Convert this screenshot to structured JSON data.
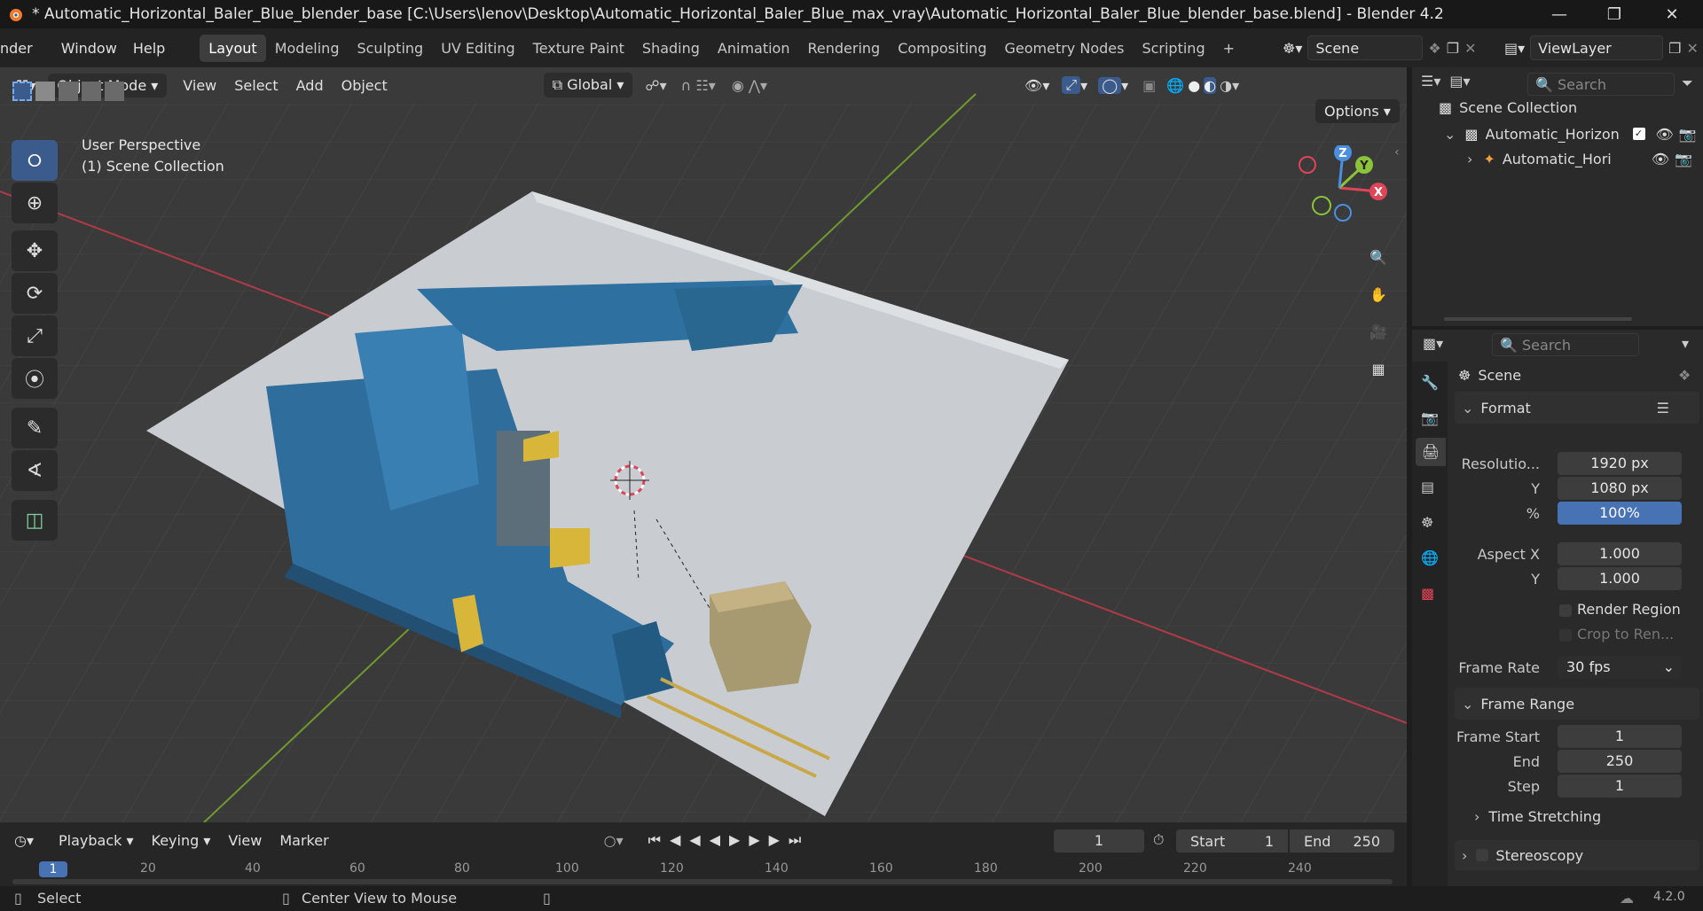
{
  "app": {
    "title": "* Automatic_Horizontal_Baler_Blue_blender_base [C:\\Users\\lenov\\Desktop\\Automatic_Horizontal_Baler_Blue_max_vray\\Automatic_Horizontal_Baler_Blue_blender_base.blend] - Blender 4.2"
  },
  "menu": {
    "items": [
      "nder",
      "Window",
      "Help"
    ]
  },
  "workspaces": {
    "tabs": [
      "Layout",
      "Modeling",
      "Sculpting",
      "UV Editing",
      "Texture Paint",
      "Shading",
      "Animation",
      "Rendering",
      "Compositing",
      "Geometry Nodes",
      "Scripting"
    ],
    "active": "Layout",
    "add": "+"
  },
  "topright": {
    "scene": "Scene",
    "viewlayer": "ViewLayer"
  },
  "viewport": {
    "mode": "Object Mode",
    "menus": [
      "View",
      "Select",
      "Add",
      "Object"
    ],
    "transform": "Global",
    "options": "Options",
    "overlay_line1": "User Perspective",
    "overlay_line2": "(1) Scene Collection",
    "gizmo": {
      "x": "X",
      "y": "Y",
      "z": "Z"
    }
  },
  "outliner": {
    "search_placeholder": "Search",
    "root": "Scene Collection",
    "collection": "Automatic_Horizon",
    "object": "Automatic_Hori"
  },
  "properties": {
    "search_placeholder": "Search",
    "context": "Scene",
    "format": {
      "header": "Format",
      "resolution_label": "Resolutio...",
      "res_x": "1920 px",
      "y_label": "Y",
      "res_y": "1080 px",
      "pct_label": "%",
      "pct": "100%",
      "pct_fraction": 1.0,
      "aspect_x_label": "Aspect X",
      "aspect_x": "1.000",
      "aspect_y": "1.000",
      "render_region": "Render Region",
      "crop": "Crop to Ren...",
      "frame_rate_label": "Frame Rate",
      "frame_rate": "30 fps"
    },
    "frame_range": {
      "header": "Frame Range",
      "start_label": "Frame Start",
      "start": "1",
      "end_label": "End",
      "end": "250",
      "step_label": "Step",
      "step": "1"
    },
    "time_stretching": "Time Stretching",
    "stereoscopy": "Stereoscopy"
  },
  "timeline": {
    "menus": [
      "Playback",
      "Keying",
      "View",
      "Marker"
    ],
    "current_frame": "1",
    "start_label": "Start",
    "start": "1",
    "end_label": "End",
    "end": "250",
    "ruler": [
      "20",
      "40",
      "60",
      "80",
      "100",
      "120",
      "140",
      "160",
      "180",
      "200",
      "220",
      "240"
    ],
    "playhead": "1"
  },
  "status": {
    "select": "Select",
    "center": "Center View to Mouse",
    "version": "4.2.0"
  },
  "colors": {
    "accent": "#4772b3",
    "axis_x": "#e04457",
    "axis_y": "#8bc43a",
    "axis_z": "#4a8fe0",
    "machine": "#2f6e9c"
  }
}
